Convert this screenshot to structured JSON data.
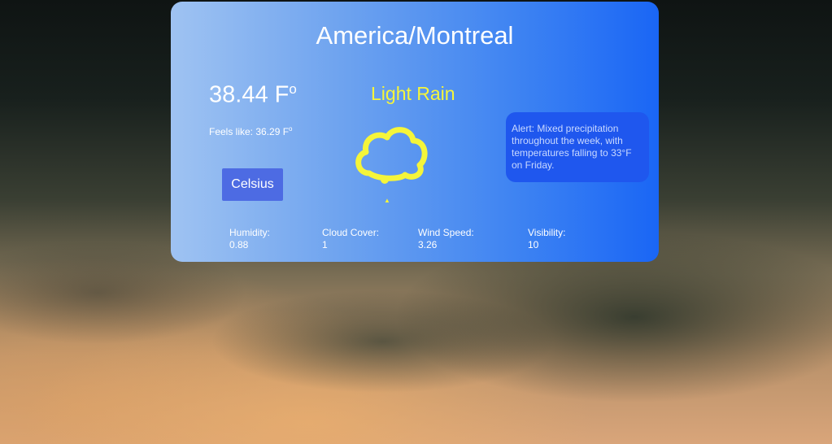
{
  "location": "America/Montreal",
  "temperature": "38.44 F",
  "temperature_unit_mark": "o",
  "feels_like": "Feels like: 36.29 F",
  "feels_like_unit_mark": "o",
  "unit_toggle_label": "Celsius",
  "condition": "Light Rain",
  "condition_icon": "cloud-icon",
  "alert": "Alert: Mixed precipitation throughout the week, with temperatures falling to 33°F on Friday.",
  "stats": [
    {
      "label": "Humidity:",
      "value": "0.88"
    },
    {
      "label": "Cloud Cover:",
      "value": "1"
    },
    {
      "label": "Wind Speed:",
      "value": "3.26"
    },
    {
      "label": "Visibility:",
      "value": "10"
    }
  ],
  "colors": {
    "card_gradient_start": "#9fc3f2",
    "card_gradient_end": "#1a66f5",
    "condition_accent": "#f5f53a",
    "button_bg": "#4d6be3",
    "alert_bg": "#1f57ee"
  }
}
